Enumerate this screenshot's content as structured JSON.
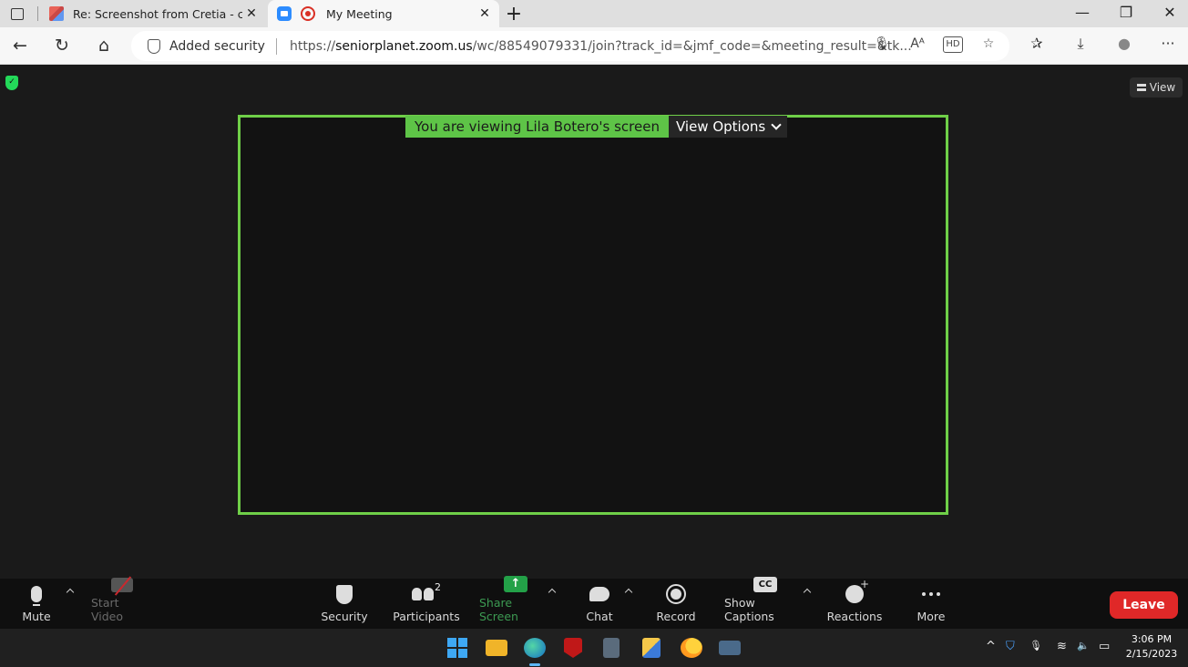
{
  "browser": {
    "tabs": [
      {
        "title": "Re: Screenshot from Cretia - credi",
        "close": "✕"
      },
      {
        "title": "My Meeting",
        "close": "✕"
      }
    ],
    "new_tab": "+",
    "window_controls": {
      "minimize": "—",
      "maximize": "❐",
      "close": "✕"
    },
    "nav": {
      "back": "←",
      "reload": "↻",
      "home": "⌂"
    },
    "address": {
      "security_label": "Added security",
      "url_prefix": "https://",
      "url_domain": "seniorplanet.zoom.us",
      "url_rest": "/wc/88549079331/join?track_id=&jmf_code=&meeting_result=&tk..."
    },
    "omni_icons": [
      "🎙",
      "Aᴬ",
      "HD",
      "☆"
    ],
    "toolbar_icons": [
      "✰",
      "⤓",
      "●",
      "···"
    ]
  },
  "meeting": {
    "view_button": "View",
    "viewing_banner": "You are viewing Lila Botero's screen",
    "view_options": "View Options",
    "colors": {
      "share_border": "#6fcf48",
      "banner_bg": "#5ec447",
      "leave": "#e02828"
    }
  },
  "toolbar": {
    "mute": "Mute",
    "start_video": "Start Video",
    "security": "Security",
    "participants": "Participants",
    "participants_count": "2",
    "share_screen": "Share Screen",
    "share_icon_glyph": "↑",
    "chat": "Chat",
    "record": "Record",
    "show_captions": "Show Captions",
    "cc_glyph": "CC",
    "reactions": "Reactions",
    "more": "More",
    "leave": "Leave"
  },
  "taskbar": {
    "tray": [
      "^",
      "⛉",
      "🎙",
      "≋",
      "🔈",
      "▭"
    ],
    "time": "3:06 PM",
    "date": "2/15/2023"
  }
}
